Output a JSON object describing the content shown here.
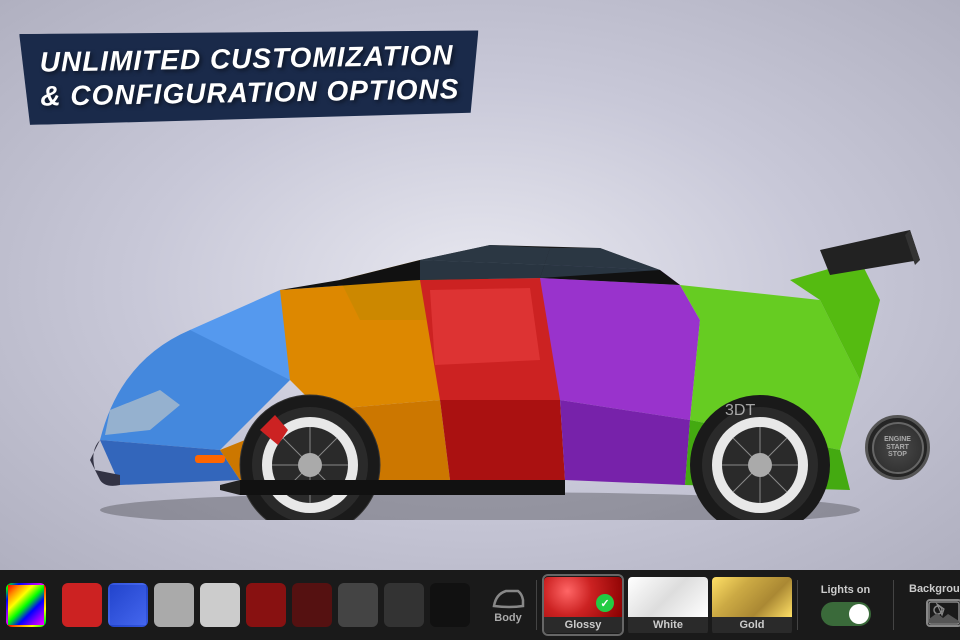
{
  "title": {
    "line1": "UNLIMITED CUSTOMIZATION",
    "line2": "& CONFIGURATION OPTIONS"
  },
  "engine_button": {
    "label": "ENGINE\nSTART\nSTOP"
  },
  "toolbar": {
    "colors": [
      {
        "name": "palette",
        "type": "palette"
      },
      {
        "name": "red",
        "hex": "#cc2222"
      },
      {
        "name": "blue",
        "hex": "#2244cc"
      },
      {
        "name": "silver",
        "hex": "#aaaaaa"
      },
      {
        "name": "light-silver",
        "hex": "#cccccc"
      },
      {
        "name": "dark-red",
        "hex": "#881111"
      },
      {
        "name": "dark-maroon",
        "hex": "#551111"
      },
      {
        "name": "charcoal",
        "hex": "#444444"
      },
      {
        "name": "dark-gray",
        "hex": "#333333"
      },
      {
        "name": "black",
        "hex": "#111111"
      }
    ],
    "body_label": "Body",
    "finish_options": [
      {
        "id": "glossy",
        "label": "Glossy",
        "color": "#cc2222",
        "selected": true
      },
      {
        "id": "white",
        "label": "White",
        "color": "#eeeeee",
        "selected": false
      },
      {
        "id": "gold",
        "label": "Gold",
        "color": "#ccaa44",
        "selected": false
      }
    ],
    "lights_label": "Lights on",
    "lights_on": true,
    "backgrounds_label": "Backgrounds"
  }
}
